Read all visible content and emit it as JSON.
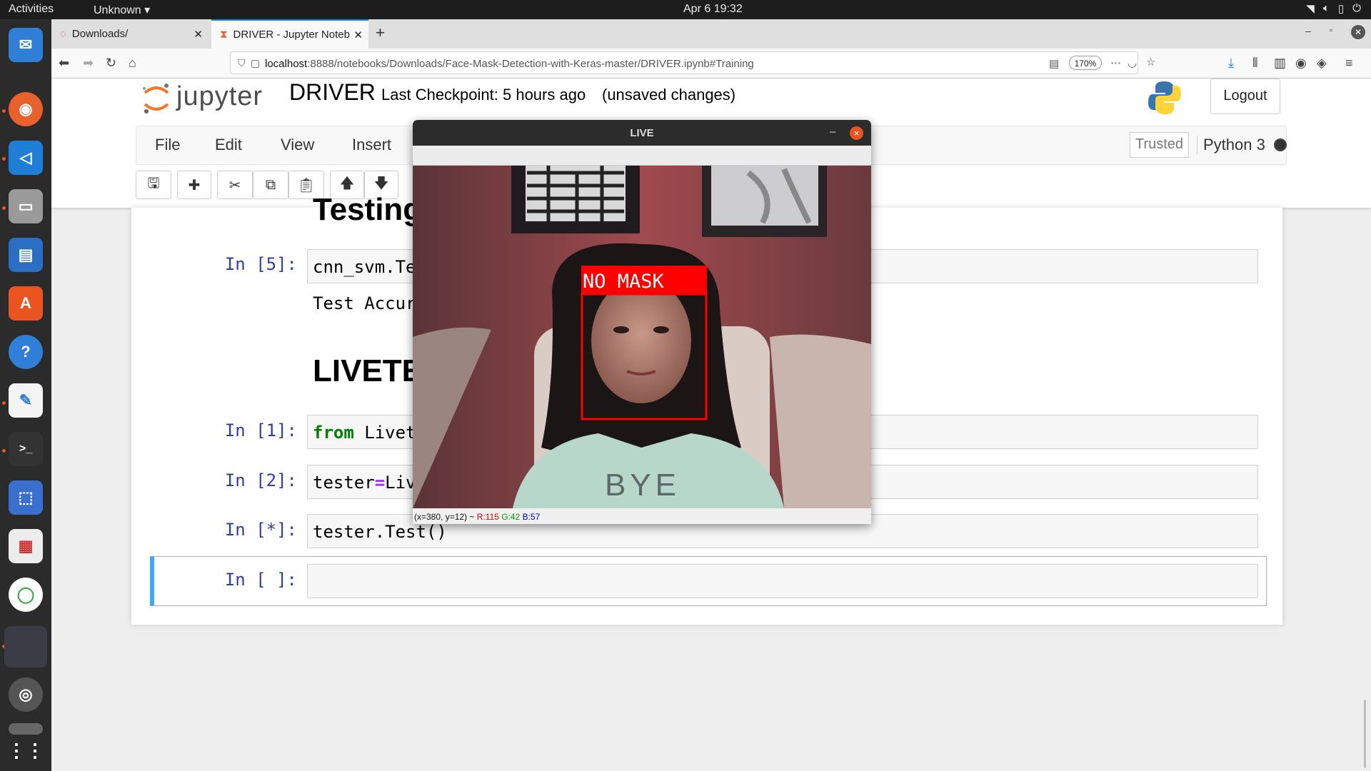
{
  "topbar": {
    "activities": "Activities",
    "app": "Unknown ▾",
    "clock": "Apr 6  19:32"
  },
  "browser": {
    "tabs": [
      {
        "label": "Downloads/"
      },
      {
        "label": "DRIVER - Jupyter Noteb"
      }
    ],
    "url_host": "localhost",
    "url_rest": ":8888/notebooks/Downloads/Face-Mask-Detection-with-Keras-master/DRIVER.ipynb#Training",
    "zoom": "170%"
  },
  "jupyter": {
    "logo_text": "jupyter",
    "notebook_name": "DRIVER",
    "checkpoint": "Last Checkpoint: 5 hours ago",
    "unsaved": "(unsaved changes)",
    "logout": "Logout",
    "menu": [
      "File",
      "Edit",
      "View",
      "Insert"
    ],
    "trusted": "Trusted",
    "kernel": "Python 3"
  },
  "cells": {
    "heading_testing": "Testing",
    "in5_prompt": "In [5]:",
    "in5_code": "cnn_svm.Te",
    "out5": "Test Accur",
    "heading_live": "LIVETE",
    "in1_prompt": "In [1]:",
    "in1_kw": "from",
    "in1_rest": " Livet",
    "in2_prompt": "In [2]:",
    "in2_a": "tester",
    "in2_op": "=",
    "in2_b": "Liv",
    "in3_prompt": "In [*]:",
    "in3_code": "tester.Test()",
    "empty_prompt": "In [ ]:"
  },
  "live_window": {
    "title": "LIVE",
    "minimize": "–",
    "close": "×",
    "label": "NO MASK",
    "shirt_text": "BYE",
    "status_coords": "(x=380, y=12) ~",
    "status_r": "R:115",
    "status_g": "G:42",
    "status_b": "B:57"
  },
  "colors": {
    "accent": "#e95420",
    "prompt_blue": "#303f9f",
    "keyword_green": "#008000",
    "box_red": "#ff0000"
  }
}
